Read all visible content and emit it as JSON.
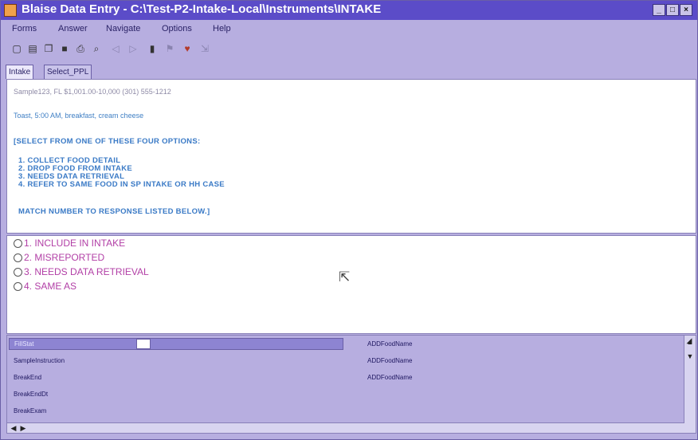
{
  "window": {
    "title": "Blaise Data Entry - C:\\Test-P2-Intake-Local\\Instruments\\INTAKE",
    "controls": [
      "_",
      "□",
      "×"
    ]
  },
  "menu": [
    "Forms",
    "Answer",
    "Navigate",
    "Options",
    "Help"
  ],
  "toolbar_icons": [
    "new-icon",
    "open-icon",
    "copy-icon",
    "save-icon",
    "print-icon",
    "preview-icon",
    "back-icon",
    "forward-icon",
    "lock-icon",
    "flag-icon",
    "heart-icon",
    "exit-icon"
  ],
  "tabs": [
    "Intake",
    "Select_PPL"
  ],
  "info": {
    "header_line": "Sample123, FL     $1,001.00-10,000     (301) 555-1212",
    "food_line": "Toast, 5:00 AM, breakfast, cream cheese",
    "instruction_open": "[SELECT FROM ONE OF THESE FOUR OPTIONS:",
    "options": [
      "1.  COLLECT FOOD DETAIL",
      "2.  DROP FOOD FROM INTAKE",
      "3.  NEEDS DATA RETRIEVAL",
      "4.  REFER TO SAME FOOD IN SP INTAKE OR HH CASE"
    ],
    "instruction_close": "MATCH NUMBER TO RESPONSE LISTED BELOW.]"
  },
  "answers": [
    "1.  INCLUDE IN INTAKE",
    "2.  MISREPORTED",
    "3.  NEEDS DATA RETRIEVAL",
    "4.  SAME AS"
  ],
  "grid": {
    "rows": [
      {
        "name": "FillStat",
        "value": "ADDFoodName"
      },
      {
        "name": "SampleInstruction",
        "value": "ADDFoodName"
      },
      {
        "name": "BreakEnd",
        "value": "ADDFoodName"
      },
      {
        "name": "BreakEndDt",
        "value": ""
      },
      {
        "name": "BreakExam",
        "value": ""
      }
    ]
  },
  "colors": {
    "titlebar": "#5b4cc8",
    "window_bg": "#b7aee0",
    "question_blue": "#3a7ac6",
    "answer_magenta": "#b23fa6"
  }
}
